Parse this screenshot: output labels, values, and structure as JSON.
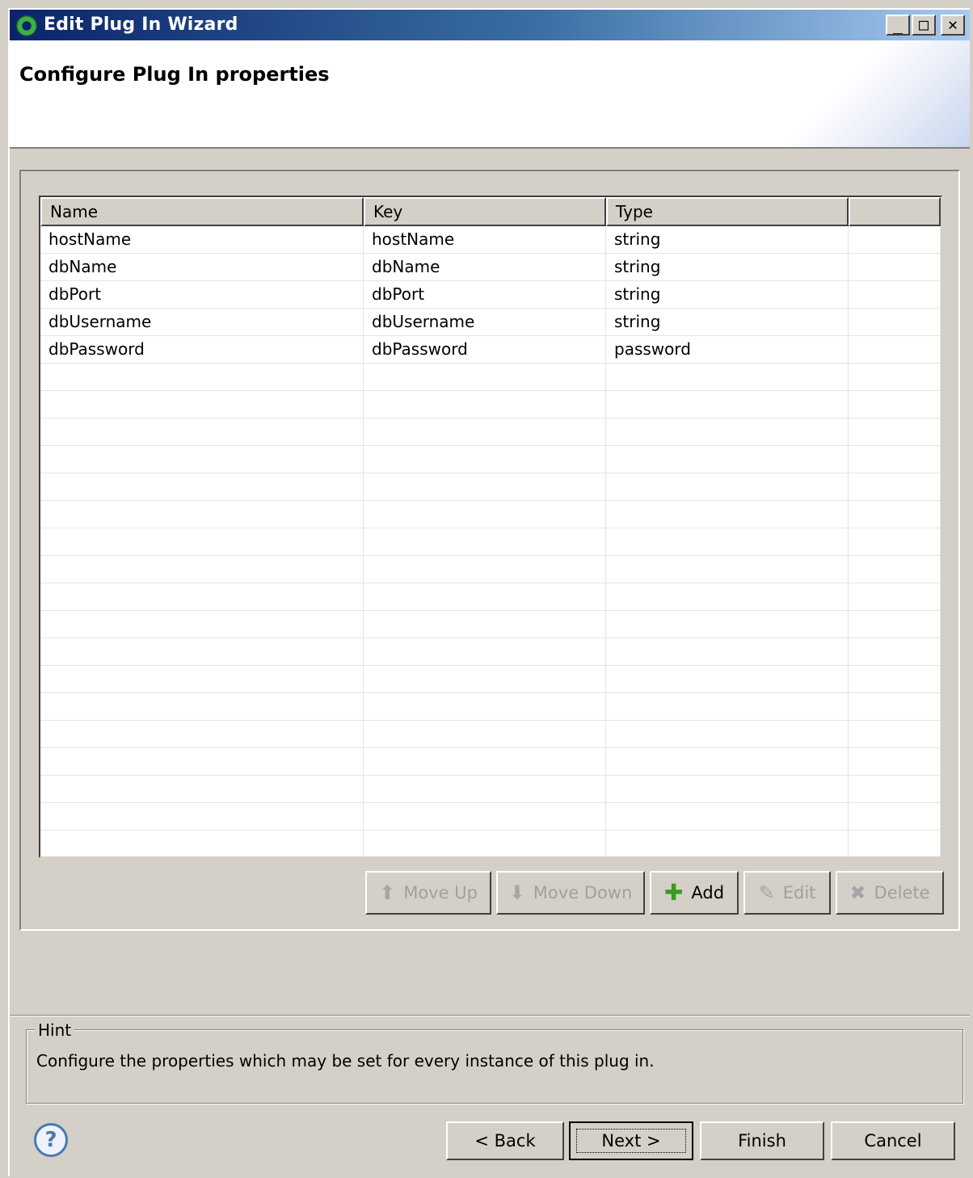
{
  "window": {
    "title": "Edit Plug In Wizard",
    "min_glyph": "_",
    "max_glyph": "□",
    "close_glyph": "✕"
  },
  "header": {
    "title": "Configure Plug In properties"
  },
  "table": {
    "columns": [
      "Name",
      "Key",
      "Type",
      ""
    ],
    "rows": [
      {
        "name": "hostName",
        "key": "hostName",
        "type": "string"
      },
      {
        "name": "dbName",
        "key": "dbName",
        "type": "string"
      },
      {
        "name": "dbPort",
        "key": "dbPort",
        "type": "string"
      },
      {
        "name": "dbUsername",
        "key": "dbUsername",
        "type": "string"
      },
      {
        "name": "dbPassword",
        "key": "dbPassword",
        "type": "password"
      }
    ]
  },
  "actions": {
    "move_up": {
      "label": "Move Up",
      "icon": "arrow-up-icon",
      "enabled": false
    },
    "move_down": {
      "label": "Move Down",
      "icon": "arrow-down-icon",
      "enabled": false
    },
    "add": {
      "label": "Add",
      "icon": "plus-icon",
      "enabled": true
    },
    "edit": {
      "label": "Edit",
      "icon": "edit-icon",
      "enabled": false
    },
    "delete": {
      "label": "Delete",
      "icon": "delete-icon",
      "enabled": false
    }
  },
  "hint": {
    "legend": "Hint",
    "text": "Configure the properties which may be set for every instance of this plug in."
  },
  "nav": {
    "help_glyph": "?",
    "back": "< Back",
    "next": "Next >",
    "finish": "Finish",
    "cancel": "Cancel"
  }
}
